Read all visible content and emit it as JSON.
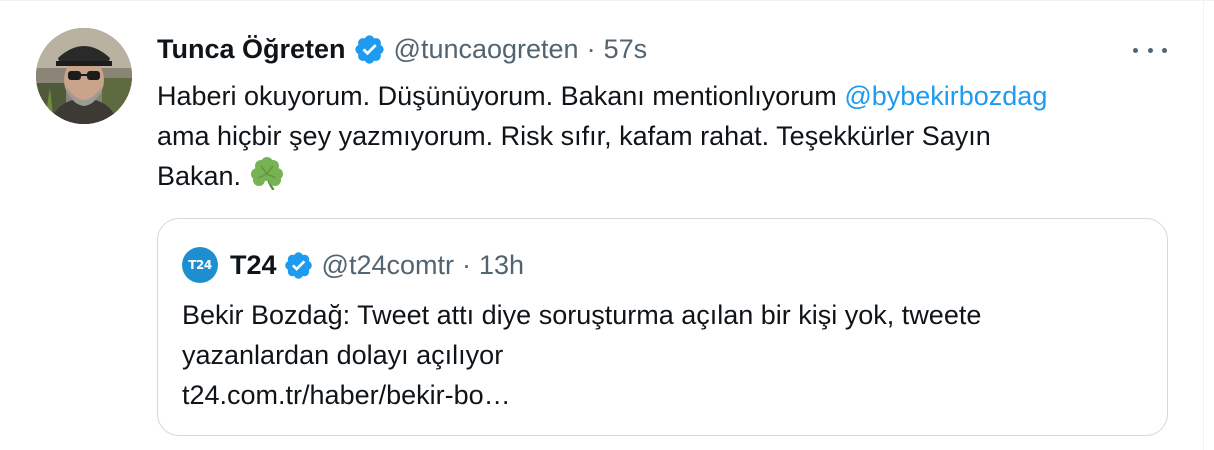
{
  "tweet": {
    "author": {
      "name": "Tunca Öğreten",
      "handle": "@tuncaogreten",
      "verified": true
    },
    "separator": "·",
    "time": "57s",
    "text": {
      "line1_prefix": "Haberi okuyorum. Düşünüyorum. Bakanı mentionlıyorum ",
      "mention": "@bybekirbozdag",
      "line2": "ama hiçbir şey yazmıyorum. Risk sıfır, kafam rahat. Teşekkürler Sayın",
      "line3": "Bakan.",
      "emoji": "clover-icon"
    },
    "menu": "more-icon"
  },
  "quote": {
    "author": {
      "avatar_text": "T24",
      "name": "T24",
      "handle": "@t24comtr",
      "verified": true
    },
    "separator": "·",
    "time": "13h",
    "text": {
      "line1": "Bekir Bozdağ: Tweet attı diye soruşturma açılan bir kişi yok, tweete",
      "line2": "yazanlardan dolayı açılıyor",
      "link": "t24.com.tr/haber/bekir-bo…"
    }
  },
  "colors": {
    "text": "#0f1419",
    "secondary": "#536471",
    "accent": "#1d9bf0",
    "border": "#cfd9de",
    "t24_brand": "#1d8fd0"
  }
}
